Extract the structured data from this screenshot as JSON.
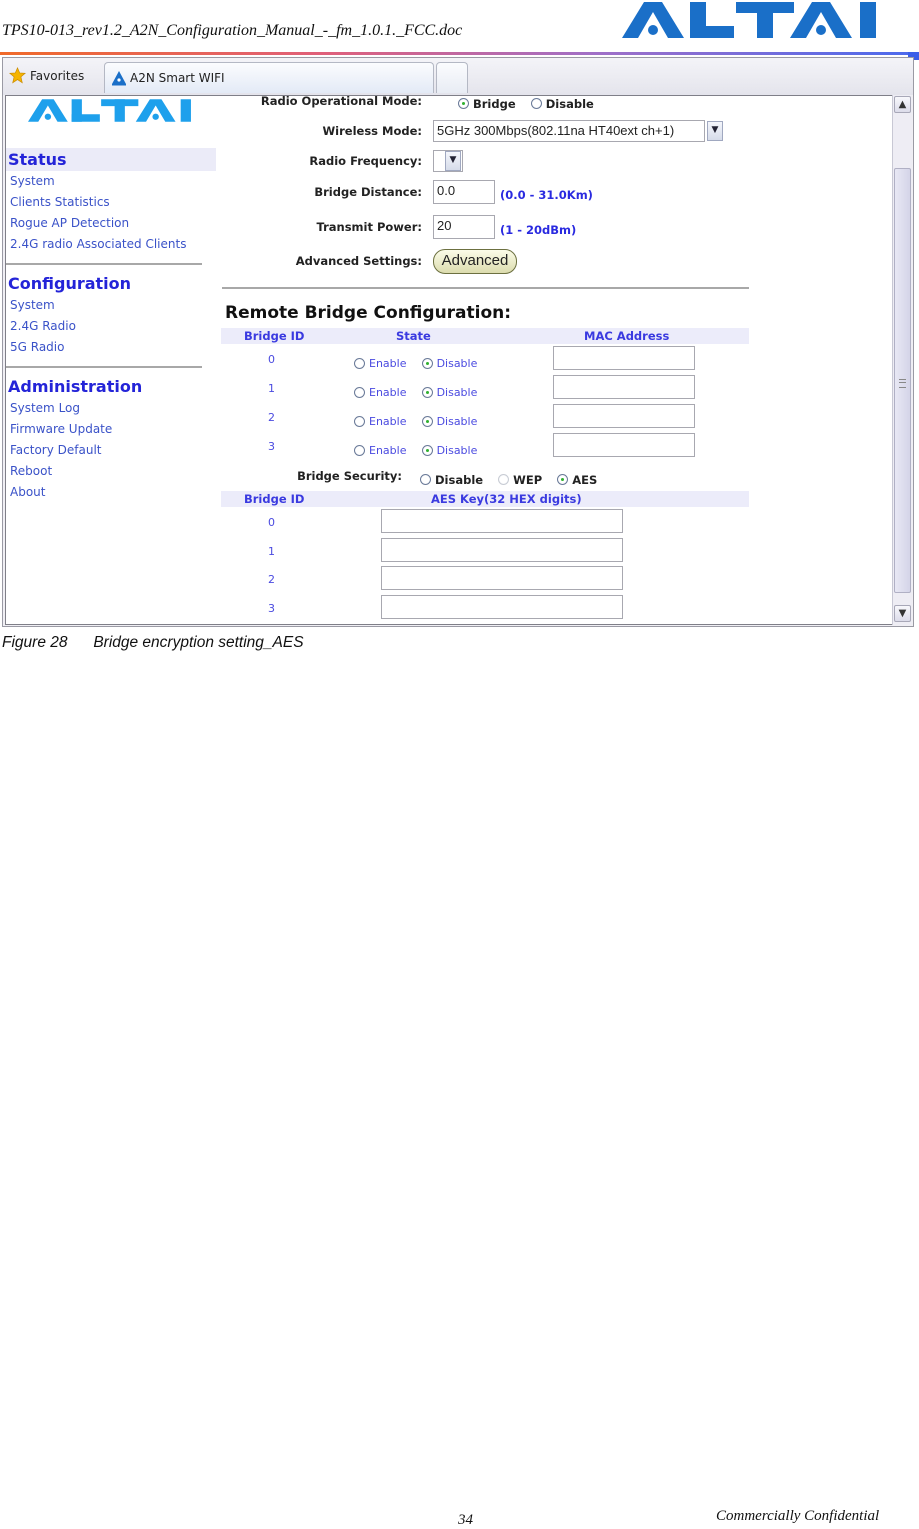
{
  "document": {
    "header_filename": "TPS10-013_rev1.2_A2N_Configuration_Manual_-_fm_1.0.1._FCC.doc",
    "header_logo": "ALTAI",
    "caption": "Figure 28      Bridge encryption setting_AES",
    "page_number": "34",
    "footer_text": "Commercially Confidential",
    "brand_color": "#1a6fc8"
  },
  "browser": {
    "favorites_label": "Favorites",
    "tab_title": "A2N Smart WIFI"
  },
  "sidebar": {
    "logo": "ALTAI",
    "sections": [
      {
        "title": "Status",
        "items": [
          "System",
          "Clients Statistics",
          "Rogue AP Detection",
          "2.4G radio Associated Clients"
        ]
      },
      {
        "title": "Configuration",
        "items": [
          "System",
          "2.4G Radio",
          "5G Radio"
        ]
      },
      {
        "title": "Administration",
        "items": [
          "System Log",
          "Firmware Update",
          "Factory Default",
          "Reboot",
          "About"
        ]
      }
    ]
  },
  "form": {
    "radio_mode_label": "Radio Operational Mode:",
    "radio_mode_options": [
      "Bridge",
      "Disable"
    ],
    "radio_mode_selected": "Bridge",
    "wireless_mode_label": "Wireless Mode:",
    "wireless_mode_value": "5GHz 300Mbps(802.11na HT40ext ch+1)",
    "radio_frequency_label": "Radio Frequency:",
    "radio_frequency_value": "",
    "bridge_distance_label": "Bridge Distance:",
    "bridge_distance_value": "0.0",
    "bridge_distance_hint": "(0.0 - 31.0Km)",
    "transmit_power_label": "Transmit Power:",
    "transmit_power_value": "20",
    "transmit_power_hint": "(1 - 20dBm)",
    "advanced_label": "Advanced Settings:",
    "advanced_button": "Advanced"
  },
  "remote_bridge": {
    "title": "Remote Bridge Configuration:",
    "headers": [
      "Bridge ID",
      "State",
      "MAC Address"
    ],
    "state_options": [
      "Enable",
      "Disable"
    ],
    "rows": [
      {
        "id": "0",
        "state": "Disable",
        "mac": ""
      },
      {
        "id": "1",
        "state": "Disable",
        "mac": ""
      },
      {
        "id": "2",
        "state": "Disable",
        "mac": ""
      },
      {
        "id": "3",
        "state": "Disable",
        "mac": ""
      }
    ],
    "security_label": "Bridge Security:",
    "security_options": [
      "Disable",
      "WEP",
      "AES"
    ],
    "security_selected": "AES",
    "key_headers": [
      "Bridge ID",
      "AES Key(32 HEX digits)"
    ],
    "key_rows": [
      {
        "id": "0",
        "key": ""
      },
      {
        "id": "1",
        "key": ""
      },
      {
        "id": "2",
        "key": ""
      },
      {
        "id": "3",
        "key": ""
      }
    ]
  }
}
